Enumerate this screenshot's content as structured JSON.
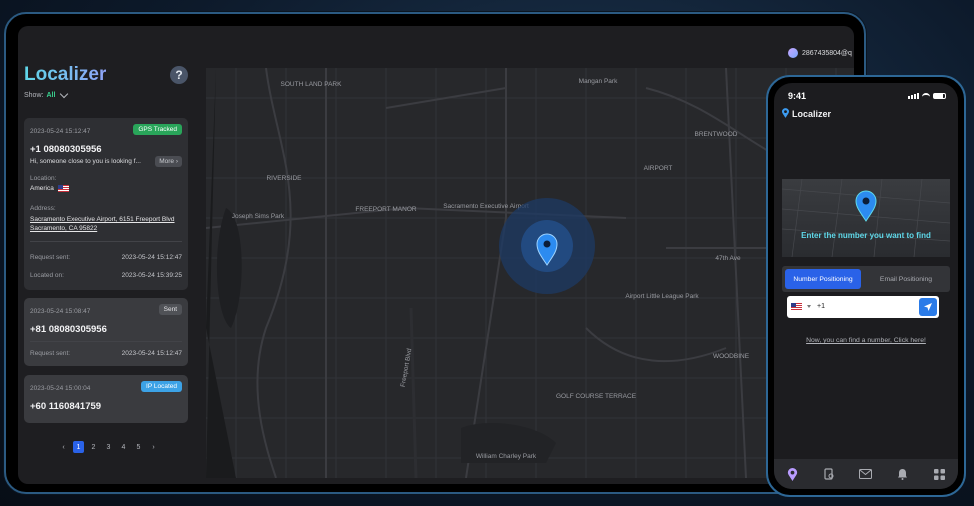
{
  "app": {
    "name": "Localizer",
    "help_label": "?"
  },
  "user": {
    "account": "2867435804@q"
  },
  "filter": {
    "label": "Show:",
    "value": "All"
  },
  "cards": [
    {
      "date": "2023-05-24 15:12:47",
      "badge": "GPS Tracked",
      "phone": "+1 08080305956",
      "message": "Hi, someone close to you is looking f...",
      "more": "More",
      "location_label": "Location:",
      "location": "America",
      "address_label": "Address:",
      "address_line1": "Sacramento Executive Airport, 6151 Freeport Blvd",
      "address_line2": "Sacramento, CA 95822",
      "request_label": "Request sent:",
      "request_value": "2023-05-24 15:12:47",
      "located_label": "Located on:",
      "located_value": "2023-05-24 15:39:25"
    },
    {
      "date": "2023-05-24 15:08:47",
      "badge": "Sent",
      "phone": "+81 08080305956",
      "request_label": "Request sent:",
      "request_value": "2023-05-24 15:12:47"
    },
    {
      "date": "2023-05-24 15:00:04",
      "badge": "IP Located",
      "phone": "+60 1160841759"
    }
  ],
  "pagination": {
    "prev": "‹",
    "pages": [
      "1",
      "2",
      "3",
      "4",
      "5"
    ],
    "next": "›"
  },
  "map": {
    "labels": [
      "SOUTH LAND PARK",
      "RIVERSIDE",
      "Joseph Sims Park",
      "FREEPORT MANOR",
      "Sacramento Executive Airport",
      "Mangan Park",
      "BRENTWOOD",
      "AIRPORT",
      "Airport Little League Park",
      "WOODBINE",
      "GOLF COURSE TERRACE",
      "William Charley Park",
      "47th Ave",
      "Freeport Blvd"
    ]
  },
  "phone": {
    "time": "9:41",
    "app_name": "Localizer",
    "hero_title": "Enter the number you want to find",
    "tab_number": "Number Positioning",
    "tab_email": "Email Positioning",
    "country_code": "+1",
    "help_link": "Now, you can find a number, Click here!",
    "nav_icons": [
      "location-icon",
      "phone-search-icon",
      "mail-icon",
      "bell-icon",
      "grid-icon"
    ]
  },
  "colors": {
    "accent_blue": "#2a62e8",
    "gps_green": "#29a55a",
    "ip_blue": "#3ca2e6",
    "logo_cyan": "#5fd7e9",
    "map_bg": "#27282b"
  }
}
